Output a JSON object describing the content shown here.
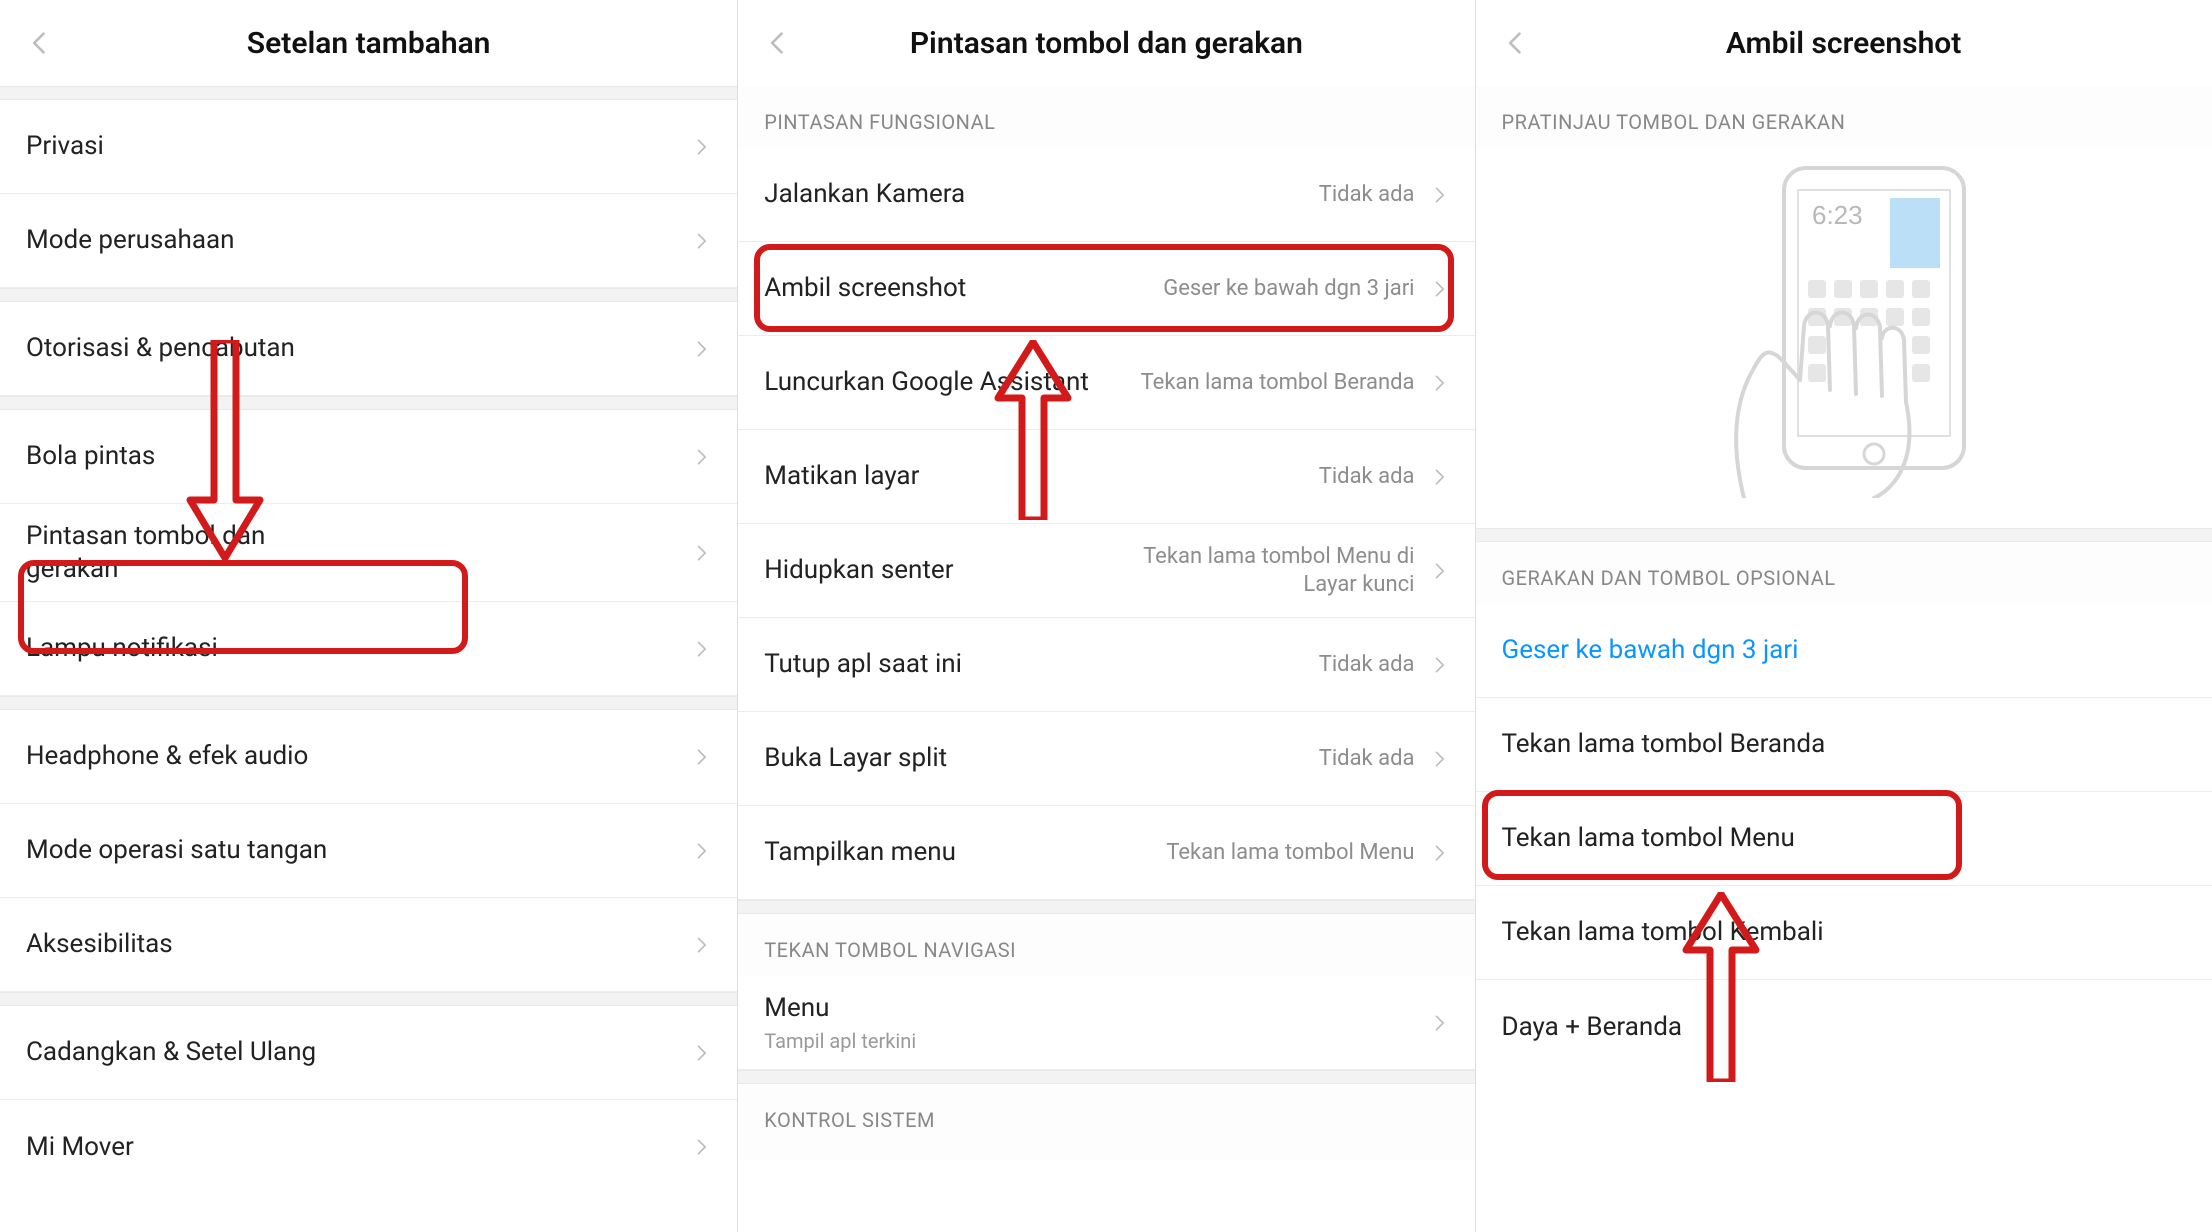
{
  "screens": [
    {
      "title": "Setelan tambahan",
      "groups": [
        {
          "items": [
            {
              "label": "Privasi"
            },
            {
              "label": "Mode perusahaan"
            }
          ]
        },
        {
          "items": [
            {
              "label": "Otorisasi & pencabutan"
            }
          ]
        },
        {
          "items": [
            {
              "label": "Bola pintas"
            },
            {
              "label": "Pintasan tombol dan gerakan"
            },
            {
              "label": "Lampu notifikasi"
            }
          ]
        },
        {
          "items": [
            {
              "label": "Headphone & efek audio"
            },
            {
              "label": "Mode operasi satu tangan"
            },
            {
              "label": "Aksesibilitas"
            }
          ]
        },
        {
          "items": [
            {
              "label": "Cadangkan & Setel Ulang"
            },
            {
              "label": "Mi Mover"
            }
          ]
        }
      ]
    },
    {
      "title": "Pintasan tombol dan gerakan",
      "sections": {
        "functional": "PINTASAN FUNGSIONAL",
        "navpress": "TEKAN TOMBOL NAVIGASI",
        "system": "KONTROL SISTEM"
      },
      "functional_items": [
        {
          "label": "Jalankan Kamera",
          "value": "Tidak ada"
        },
        {
          "label": "Ambil screenshot",
          "value": "Geser ke bawah dgn 3 jari"
        },
        {
          "label": "Luncurkan Google Assistant",
          "value": "Tekan lama tombol Beranda"
        },
        {
          "label": "Matikan layar",
          "value": "Tidak ada"
        },
        {
          "label": "Hidupkan senter",
          "value": "Tekan lama tombol Menu di Layar kunci"
        },
        {
          "label": "Tutup apl saat ini",
          "value": "Tidak ada"
        },
        {
          "label": "Buka Layar split",
          "value": "Tidak ada"
        },
        {
          "label": "Tampilkan menu",
          "value": "Tekan lama tombol Menu"
        }
      ],
      "nav_items": [
        {
          "label": "Menu",
          "sub": "Tampil apl terkini"
        }
      ]
    },
    {
      "title": "Ambil screenshot",
      "sections": {
        "preview": "PRATINJAU TOMBOL DAN GERAKAN",
        "optional": "GERAKAN DAN TOMBOL OPSIONAL"
      },
      "preview_clock": "6:23",
      "options": [
        {
          "label": "Geser ke bawah dgn 3 jari",
          "selected": true
        },
        {
          "label": "Tekan lama tombol Beranda"
        },
        {
          "label": "Tekan lama tombol Menu"
        },
        {
          "label": "Tekan lama tombol Kembali"
        },
        {
          "label": "Daya + Beranda"
        }
      ]
    }
  ]
}
